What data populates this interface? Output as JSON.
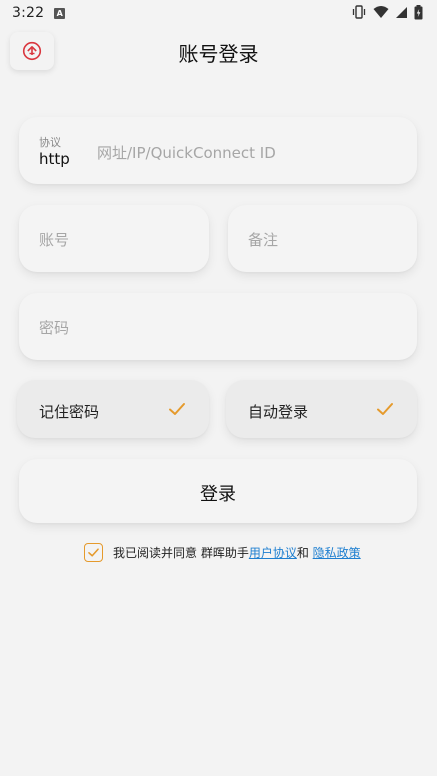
{
  "status_bar": {
    "time": "3:22",
    "notification_icon": "A"
  },
  "header": {
    "back_icon": "home-up-icon",
    "title": "账号登录"
  },
  "form": {
    "protocol_label": "协议",
    "protocol_value": "http",
    "address_placeholder": "网址/IP/QuickConnect ID",
    "account_placeholder": "账号",
    "remark_placeholder": "备注",
    "password_placeholder": "密码"
  },
  "options": {
    "remember_password": "记住密码",
    "auto_login": "自动登录"
  },
  "login_button": "登录",
  "agreement": {
    "prefix": "我已阅读并同意 群晖助手",
    "user_agreement": "用户协议",
    "and": "和 ",
    "privacy_policy": "隐私政策"
  },
  "colors": {
    "accent": "#e59a2c",
    "link": "#1e7fd0",
    "back_icon": "#d9363e",
    "background": "#f3f3f3"
  }
}
